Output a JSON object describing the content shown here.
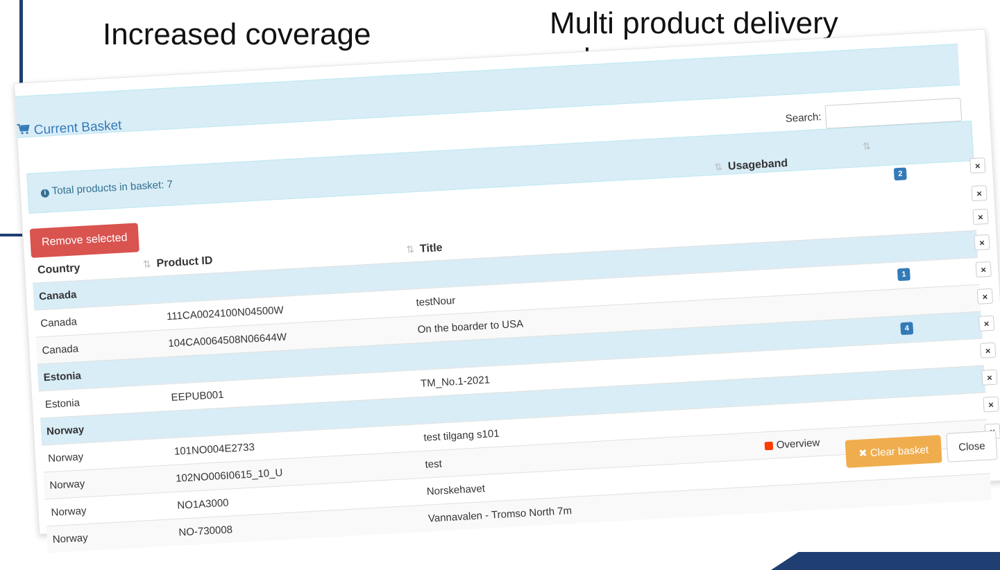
{
  "slide": {
    "heading_left": "Increased coverage",
    "heading_right": "Multi product delivery enhancements"
  },
  "modal": {
    "close_x": "×",
    "title": "Current Basket",
    "search_label": "Search:",
    "search_value": "",
    "info_text": "Total products in basket: 7",
    "remove_selected_label": "Remove selected",
    "columns": {
      "country": "Country",
      "product_id": "Product ID",
      "title": "Title",
      "usageband": "Usageband"
    },
    "rows": [
      {
        "kind": "group",
        "country": "Canada",
        "product_id": "",
        "title": "",
        "usage": "",
        "badge": ""
      },
      {
        "kind": "item",
        "country": "Canada",
        "product_id": "111CA0024100N04500W",
        "title": "testNour",
        "usage": "",
        "badge": "1"
      },
      {
        "kind": "item",
        "country": "Canada",
        "product_id": "104CA0064508N06644W",
        "title": "On the boarder to USA",
        "usage": "",
        "badge": ""
      },
      {
        "kind": "group",
        "country": "Estonia",
        "product_id": "",
        "title": "",
        "usage": "",
        "badge": "4"
      },
      {
        "kind": "item",
        "country": "Estonia",
        "product_id": "EEPUB001",
        "title": "TM_No.1-2021",
        "usage": "",
        "badge": ""
      },
      {
        "kind": "group",
        "country": "Norway",
        "product_id": "",
        "title": "",
        "usage": "",
        "badge": ""
      },
      {
        "kind": "item",
        "country": "Norway",
        "product_id": "101NO004E2733",
        "title": "test tilgang s101",
        "usage": "",
        "badge": ""
      },
      {
        "kind": "item",
        "country": "Norway",
        "product_id": "102NO006I0615_10_U",
        "title": "test",
        "usage": "Overview",
        "badge": ""
      },
      {
        "kind": "item",
        "country": "Norway",
        "product_id": "NO1A3000",
        "title": "Norskehavet",
        "usage": "",
        "badge": ""
      },
      {
        "kind": "item",
        "country": "Norway",
        "product_id": "NO-730008",
        "title": "Vannavalen - Tromso North 7m",
        "usage": "",
        "badge": ""
      }
    ],
    "header_badge": "2",
    "row_remove_glyph": "×",
    "clear_basket_label": "Clear basket",
    "close_label": "Close"
  },
  "colors": {
    "primary": "#337ab7",
    "danger": "#d9534f",
    "warning": "#f0ad4e",
    "info_bg": "#d9edf7",
    "frame": "#1f3f73",
    "usage_overview": "#ff3b00"
  }
}
